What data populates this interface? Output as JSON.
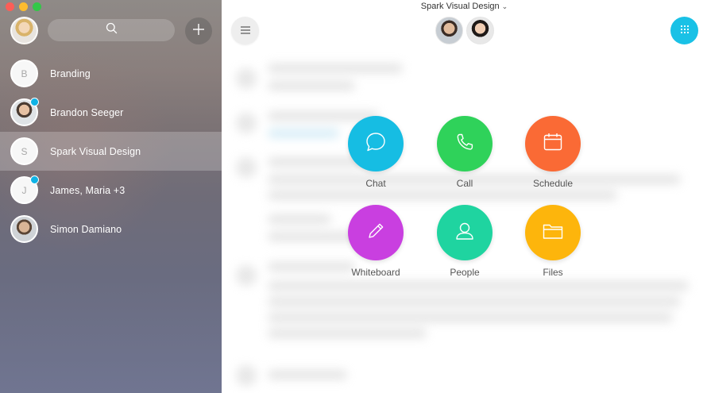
{
  "sidebar": {
    "rooms": [
      {
        "label": "Branding",
        "initial": "B"
      },
      {
        "label": "Brandon Seeger",
        "initial": ""
      },
      {
        "label": "Spark Visual Design",
        "initial": "S"
      },
      {
        "label": "James, Maria +3",
        "initial": "J"
      },
      {
        "label": "Simon Damiano",
        "initial": ""
      }
    ]
  },
  "header": {
    "room_title": "Spark Visual Design"
  },
  "actions": [
    {
      "label": "Chat",
      "color": "#16bde3"
    },
    {
      "label": "Call",
      "color": "#2fd25a"
    },
    {
      "label": "Schedule",
      "color": "#fa6a35"
    },
    {
      "label": "Whiteboard",
      "color": "#c93fe0"
    },
    {
      "label": "People",
      "color": "#1fd4a0"
    },
    {
      "label": "Files",
      "color": "#fdb50c"
    }
  ],
  "colors": {
    "accent": "#19c1e6",
    "unread": "#0fb3e6"
  }
}
